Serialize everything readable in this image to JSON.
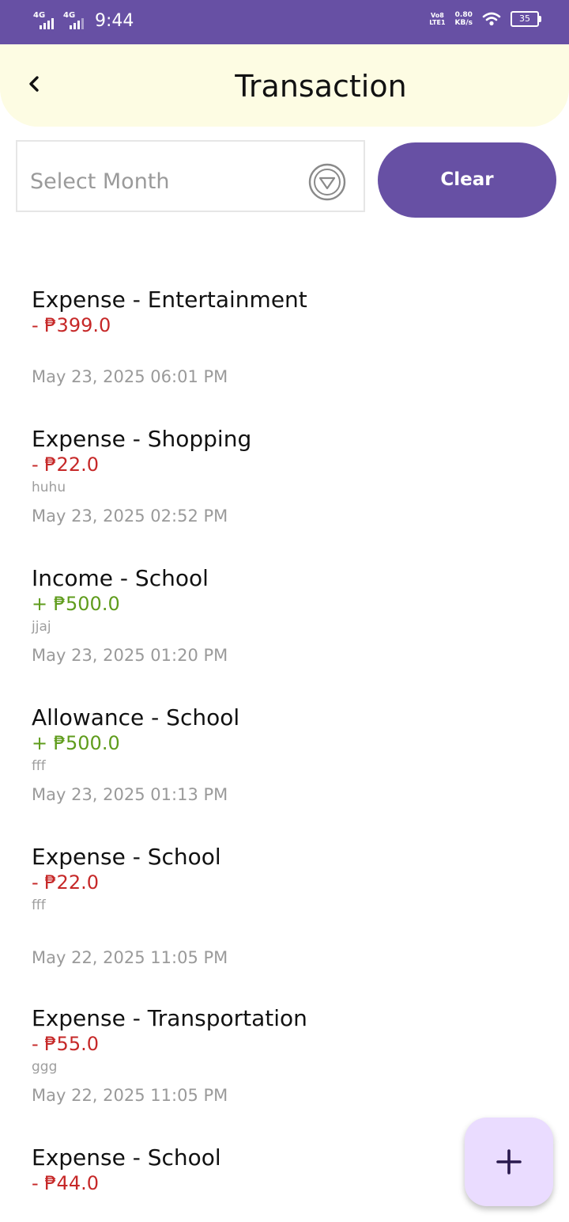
{
  "status_bar": {
    "sim1_network": "4G",
    "sim2_network": "4G",
    "time": "9:44",
    "volte_line1": "Vo8",
    "volte_line2": "LTE1",
    "net_speed_value": "0.80",
    "net_speed_unit": "KB/s",
    "battery_level": "35"
  },
  "header": {
    "title": "Transaction"
  },
  "filter": {
    "month_placeholder": "Select Month",
    "clear_label": "Clear"
  },
  "colors": {
    "brand": "#6750a4",
    "header_bg": "#fdfce3",
    "expense": "#c62828",
    "income": "#5f9c1c",
    "fab_bg": "#eadcff"
  },
  "transactions": [
    {
      "title": "Expense - Entertainment",
      "amount": "- ₱399.0",
      "kind": "expense",
      "note": "",
      "datetime": "May 23, 2025 06:01 PM"
    },
    {
      "title": "Expense - Shopping",
      "amount": "- ₱22.0",
      "kind": "expense",
      "note": "huhu",
      "datetime": "May 23, 2025 02:52 PM"
    },
    {
      "title": "Income - School",
      "amount": "+ ₱500.0",
      "kind": "income",
      "note": "jjaj",
      "datetime": "May 23, 2025 01:20 PM"
    },
    {
      "title": "Allowance - School",
      "amount": "+ ₱500.0",
      "kind": "income",
      "note": "fff",
      "datetime": "May 23, 2025 01:13 PM"
    },
    {
      "title": "Expense - School",
      "amount": "- ₱22.0",
      "kind": "expense",
      "note": "fff",
      "datetime": "May 22, 2025 11:05 PM"
    },
    {
      "title": "Expense - Transportation",
      "amount": "- ₱55.0",
      "kind": "expense",
      "note": "ggg",
      "datetime": "May 22, 2025 11:05 PM"
    },
    {
      "title": "Expense - School",
      "amount": "- ₱44.0",
      "kind": "expense",
      "note": "",
      "datetime": ""
    }
  ],
  "icons": {
    "back": "chevron-left-icon",
    "dropdown": "dropdown-triangle-icon",
    "add": "plus-icon"
  }
}
